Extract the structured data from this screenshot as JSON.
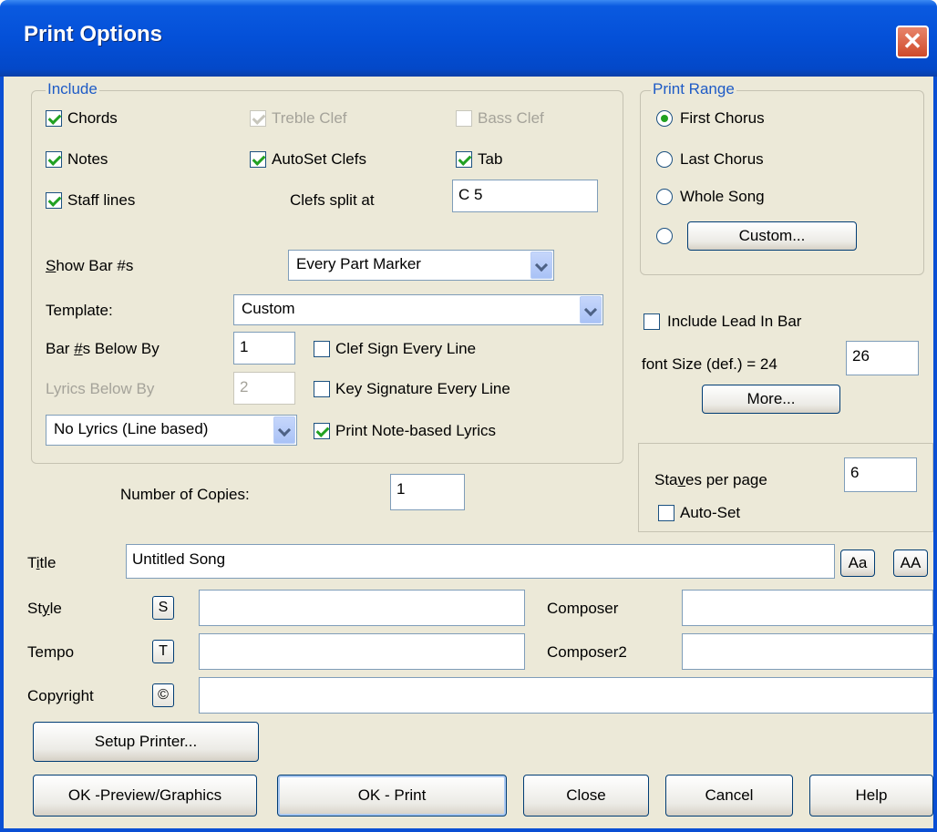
{
  "window": {
    "title": "Print Options",
    "close_glyph": "✕"
  },
  "include": {
    "legend": "Include",
    "chords": {
      "label": "Chords",
      "checked": true
    },
    "treble_clef": {
      "label": "Treble Clef",
      "checked": true,
      "disabled": true
    },
    "bass_clef": {
      "label": "Bass Clef",
      "checked": false,
      "disabled": true
    },
    "notes": {
      "label": "Notes",
      "checked": true
    },
    "autoset_clefs": {
      "label": "AutoSet Clefs",
      "checked": true
    },
    "tab": {
      "label": "Tab",
      "checked": true
    },
    "staff_lines": {
      "label": "Staff lines",
      "checked": true
    },
    "clefs_split_label": "Clefs split at",
    "clefs_split_value": "C 5",
    "show_bar_label": "Show Bar #s",
    "show_bar_value": "Every Part Marker",
    "template_label": "Template:",
    "template_value": "Custom",
    "bar_below_label": "Bar #s Below By",
    "bar_below_value": "1",
    "lyrics_below_label": "Lyrics Below By",
    "lyrics_below_value": "2",
    "lyrics_mode_value": "No Lyrics (Line based)",
    "clef_sign": {
      "label": "Clef Sign Every Line",
      "checked": false
    },
    "key_sig": {
      "label": "Key Signature Every Line",
      "checked": false
    },
    "note_lyrics": {
      "label": "Print Note-based Lyrics",
      "checked": true
    }
  },
  "print_range": {
    "legend": "Print Range",
    "options": [
      "First Chorus",
      "Last Chorus",
      "Whole Song"
    ],
    "selected": "First Chorus",
    "custom_button": "Custom..."
  },
  "lead_in": {
    "label": "Include Lead In Bar",
    "checked": false
  },
  "font_size": {
    "label": "font Size (def.) = 24",
    "value": "26"
  },
  "more_button": "More...",
  "staves": {
    "label": "Staves per page",
    "value": "6",
    "autoset_label": "Auto-Set",
    "autoset_checked": false
  },
  "copies": {
    "label": "Number of Copies:",
    "value": "1"
  },
  "fields": {
    "title_label": "Title",
    "title_value": "Untitled Song",
    "aa_small": "Aa",
    "aa_large": "AA",
    "style_label": "Style",
    "style_btn": "S",
    "style_value": "",
    "tempo_label": "Tempo",
    "tempo_btn": "T",
    "tempo_value": "",
    "copyright_label": "Copyright",
    "copyright_btn": "©",
    "copyright_value": "",
    "composer_label": "Composer",
    "composer_value": "",
    "composer2_label": "Composer2",
    "composer2_value": ""
  },
  "buttons": {
    "setup_printer": "Setup Printer...",
    "ok_preview": "OK -Preview/Graphics",
    "ok_print": "OK - Print",
    "close": "Close",
    "cancel": "Cancel",
    "help": "Help"
  }
}
